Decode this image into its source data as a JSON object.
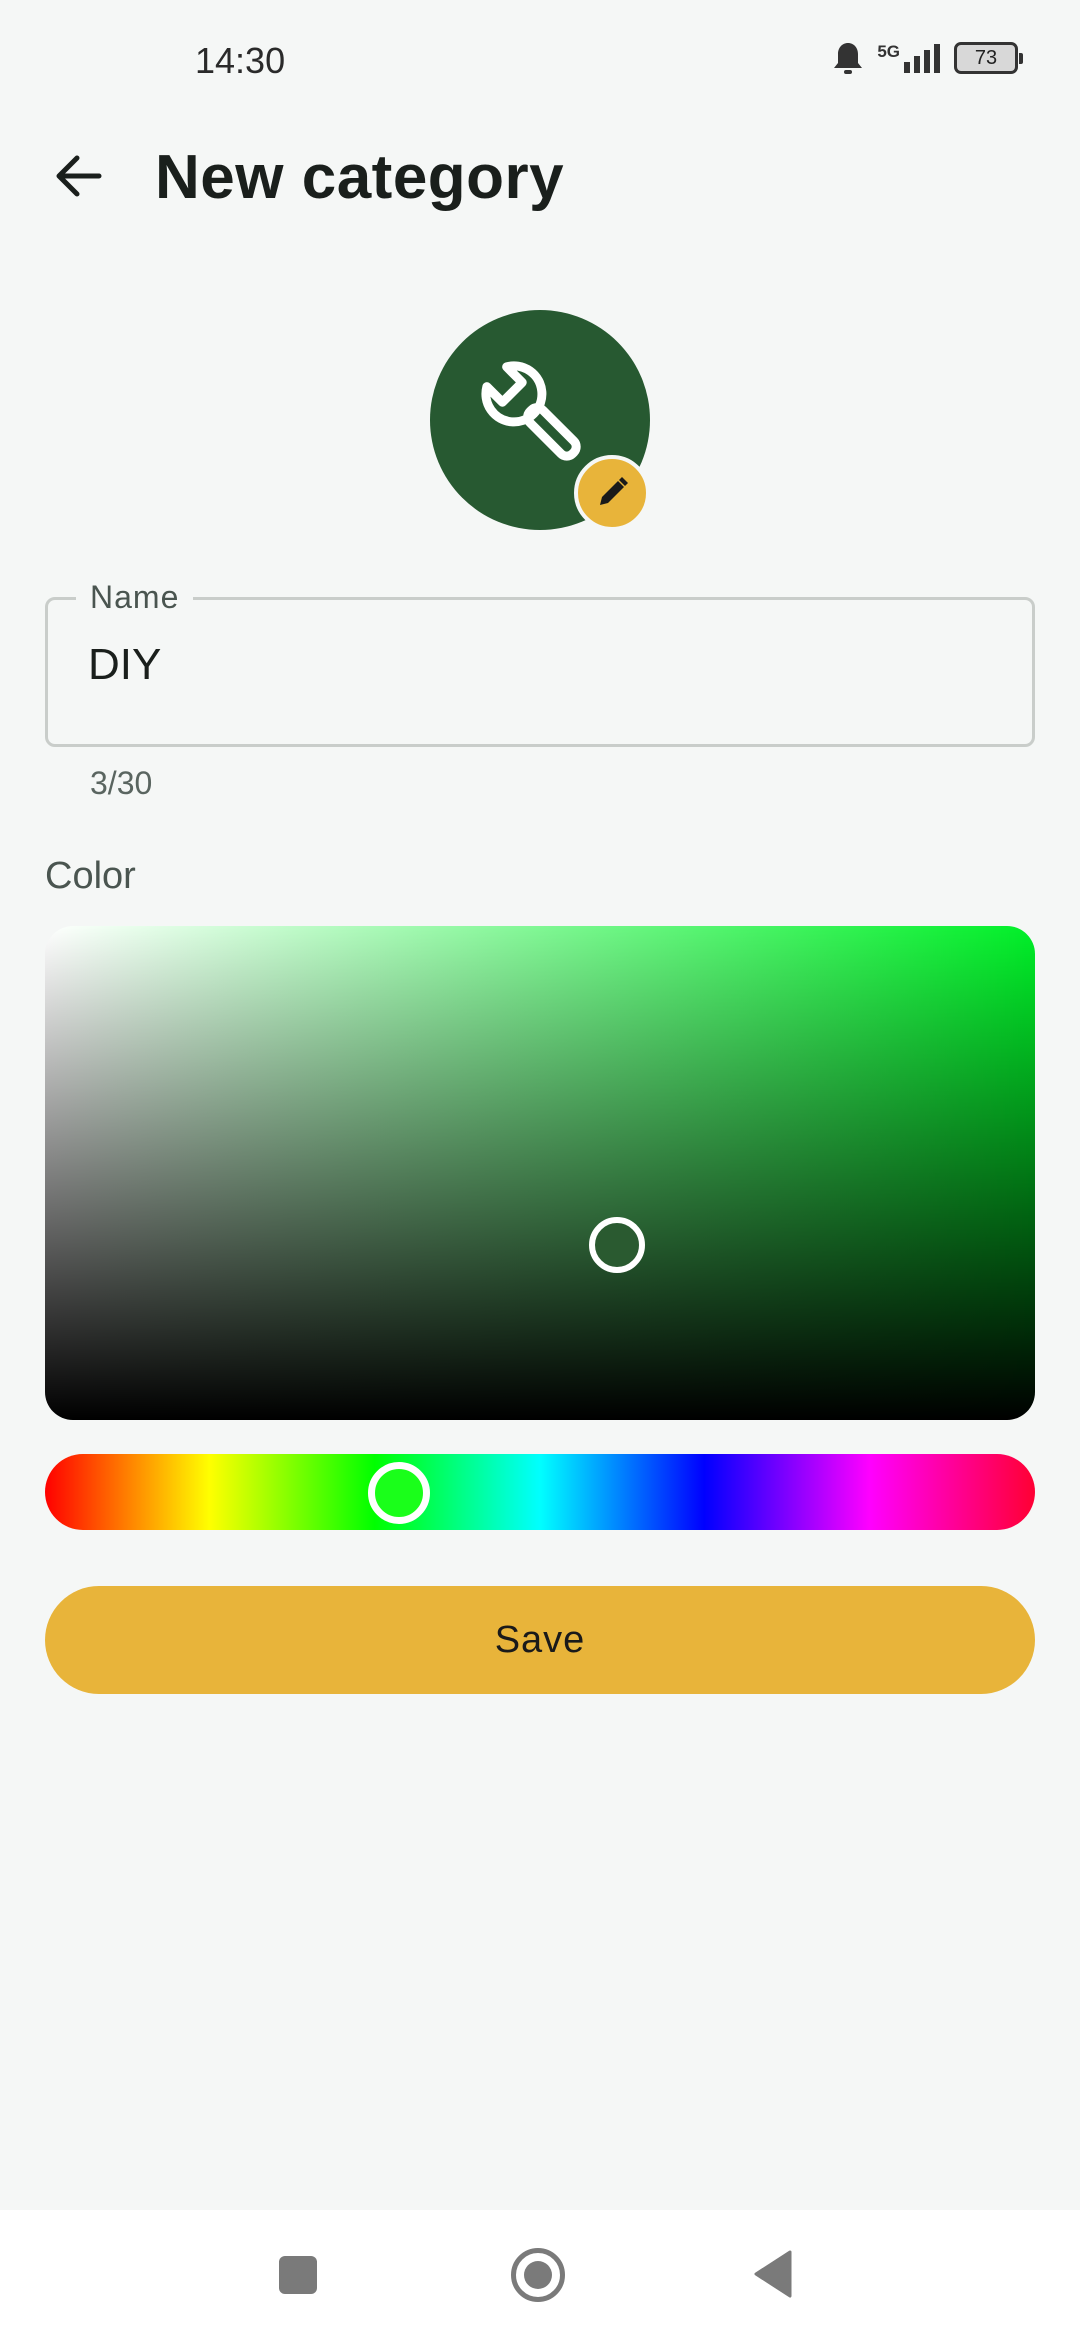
{
  "status_bar": {
    "time": "14:30",
    "network": "5G",
    "battery": "73"
  },
  "header": {
    "title": "New category",
    "back_icon": "arrow-left-icon"
  },
  "category_icon": {
    "icon": "wrench-icon",
    "background_color": "#275931",
    "edit_icon": "pencil-icon",
    "edit_badge_color": "#e8b43a"
  },
  "name_field": {
    "label": "Name",
    "value": "DIY",
    "counter": "3/30"
  },
  "color_section": {
    "label": "Color",
    "selected_color": "#275931",
    "hue_color": "#00f028"
  },
  "actions": {
    "save_label": "Save"
  },
  "nav_bar": {
    "recent_icon": "square-icon",
    "home_icon": "circle-icon",
    "back_icon": "triangle-back-icon"
  }
}
